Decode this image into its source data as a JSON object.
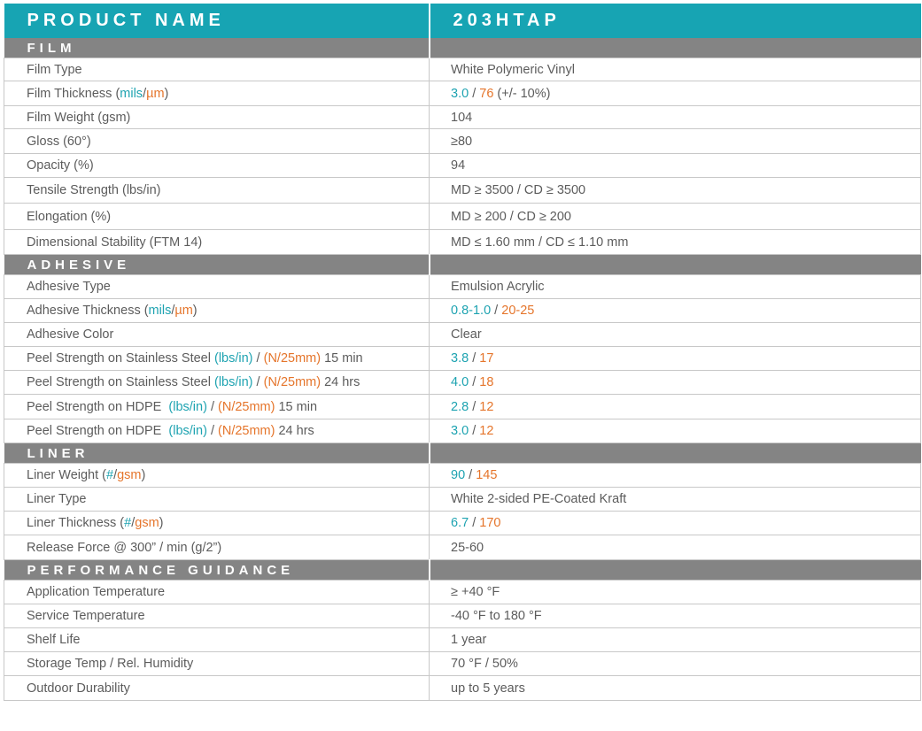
{
  "header": {
    "product_name_label": "PRODUCT NAME",
    "product_name_value": "203HTAP"
  },
  "colors": {
    "teal": "#17a4b3",
    "orange": "#e5752b",
    "section_gray": "#848484"
  },
  "sections": [
    {
      "title": "FILM",
      "rows": [
        {
          "label": [
            {
              "t": "Film Type"
            }
          ],
          "value": [
            {
              "t": "White Polymeric Vinyl"
            }
          ]
        },
        {
          "label": [
            {
              "t": "Film Thickness ("
            },
            {
              "t": "mils",
              "c": "teal"
            },
            {
              "t": "/"
            },
            {
              "t": "µm",
              "c": "orange"
            },
            {
              "t": ")"
            }
          ],
          "value": [
            {
              "t": "3.0",
              "c": "teal"
            },
            {
              "t": " / "
            },
            {
              "t": "76",
              "c": "orange"
            },
            {
              "t": " (+/- 10%)"
            }
          ]
        },
        {
          "label": [
            {
              "t": "Film Weight (gsm)"
            }
          ],
          "value": [
            {
              "t": "104"
            }
          ]
        },
        {
          "label": [
            {
              "t": "Gloss (60°)"
            }
          ],
          "value": [
            {
              "t": "≥80"
            }
          ]
        },
        {
          "label": [
            {
              "t": "Opacity (%)"
            }
          ],
          "value": [
            {
              "t": "94"
            }
          ]
        },
        {
          "label": [
            {
              "t": "Tensile Strength (lbs/in)"
            }
          ],
          "value": [
            {
              "t": "MD ≥ 3500 / CD ≥ 3500"
            }
          ]
        },
        {
          "label": [
            {
              "t": "Elongation (%)"
            }
          ],
          "value": [
            {
              "t": "MD ≥ 200 / CD ≥ 200"
            }
          ]
        },
        {
          "label": [
            {
              "t": "Dimensional Stability (FTM 14)"
            }
          ],
          "value": [
            {
              "t": "MD ≤ 1.60 mm / CD ≤ 1.10 mm"
            }
          ]
        }
      ]
    },
    {
      "title": "ADHESIVE",
      "rows": [
        {
          "label": [
            {
              "t": "Adhesive Type"
            }
          ],
          "value": [
            {
              "t": "Emulsion Acrylic"
            }
          ]
        },
        {
          "label": [
            {
              "t": "Adhesive Thickness ("
            },
            {
              "t": "mils",
              "c": "teal"
            },
            {
              "t": "/"
            },
            {
              "t": "µm",
              "c": "orange"
            },
            {
              "t": ")"
            }
          ],
          "value": [
            {
              "t": "0.8-1.0",
              "c": "teal"
            },
            {
              "t": " / "
            },
            {
              "t": "20-25",
              "c": "orange"
            }
          ]
        },
        {
          "label": [
            {
              "t": "Adhesive Color"
            }
          ],
          "value": [
            {
              "t": "Clear"
            }
          ]
        },
        {
          "label": [
            {
              "t": "Peel Strength on Stainless Steel "
            },
            {
              "t": "(lbs/in)",
              "c": "teal"
            },
            {
              "t": " / "
            },
            {
              "t": "(N/25mm)",
              "c": "orange"
            },
            {
              "t": " 15 min"
            }
          ],
          "value": [
            {
              "t": "3.8",
              "c": "teal"
            },
            {
              "t": " / "
            },
            {
              "t": "17",
              "c": "orange"
            }
          ]
        },
        {
          "label": [
            {
              "t": "Peel Strength on Stainless Steel "
            },
            {
              "t": "(lbs/in)",
              "c": "teal"
            },
            {
              "t": " / "
            },
            {
              "t": "(N/25mm)",
              "c": "orange"
            },
            {
              "t": " 24 hrs"
            }
          ],
          "value": [
            {
              "t": "4.0",
              "c": "teal"
            },
            {
              "t": " / "
            },
            {
              "t": "18",
              "c": "orange"
            }
          ]
        },
        {
          "label": [
            {
              "t": "Peel Strength on HDPE  "
            },
            {
              "t": "(lbs/in)",
              "c": "teal"
            },
            {
              "t": " / "
            },
            {
              "t": "(N/25mm)",
              "c": "orange"
            },
            {
              "t": " 15 min"
            }
          ],
          "value": [
            {
              "t": "2.8",
              "c": "teal"
            },
            {
              "t": " / "
            },
            {
              "t": "12",
              "c": "orange"
            }
          ]
        },
        {
          "label": [
            {
              "t": "Peel Strength on HDPE  "
            },
            {
              "t": "(lbs/in)",
              "c": "teal"
            },
            {
              "t": " / "
            },
            {
              "t": "(N/25mm)",
              "c": "orange"
            },
            {
              "t": " 24 hrs"
            }
          ],
          "value": [
            {
              "t": "3.0",
              "c": "teal"
            },
            {
              "t": " / "
            },
            {
              "t": "12",
              "c": "orange"
            }
          ]
        }
      ]
    },
    {
      "title": "LINER",
      "rows": [
        {
          "label": [
            {
              "t": "Liner Weight ("
            },
            {
              "t": "#",
              "c": "teal"
            },
            {
              "t": "/"
            },
            {
              "t": "gsm",
              "c": "orange"
            },
            {
              "t": ")"
            }
          ],
          "value": [
            {
              "t": "90",
              "c": "teal"
            },
            {
              "t": " / "
            },
            {
              "t": "145",
              "c": "orange"
            }
          ]
        },
        {
          "label": [
            {
              "t": "Liner Type"
            }
          ],
          "value": [
            {
              "t": "White 2-sided PE-Coated Kraft"
            }
          ]
        },
        {
          "label": [
            {
              "t": "Liner Thickness ("
            },
            {
              "t": "#",
              "c": "teal"
            },
            {
              "t": "/"
            },
            {
              "t": "gsm",
              "c": "orange"
            },
            {
              "t": ")"
            }
          ],
          "value": [
            {
              "t": "6.7",
              "c": "teal"
            },
            {
              "t": " / "
            },
            {
              "t": "170",
              "c": "orange"
            }
          ]
        },
        {
          "label": [
            {
              "t": "Release Force @ 300” / min (g/2”)"
            }
          ],
          "value": [
            {
              "t": "25-60"
            }
          ]
        }
      ]
    },
    {
      "title": "PERFORMANCE GUIDANCE",
      "rows": [
        {
          "label": [
            {
              "t": "Application Temperature"
            }
          ],
          "value": [
            {
              "t": "≥ +40 °F"
            }
          ]
        },
        {
          "label": [
            {
              "t": "Service Temperature"
            }
          ],
          "value": [
            {
              "t": "-40 °F to 180 °F"
            }
          ]
        },
        {
          "label": [
            {
              "t": "Shelf Life"
            }
          ],
          "value": [
            {
              "t": "1 year"
            }
          ]
        },
        {
          "label": [
            {
              "t": "Storage Temp / Rel. Humidity"
            }
          ],
          "value": [
            {
              "t": "70 °F / 50%"
            }
          ]
        },
        {
          "label": [
            {
              "t": "Outdoor Durability"
            }
          ],
          "value": [
            {
              "t": "up to 5 years"
            }
          ]
        }
      ]
    }
  ]
}
